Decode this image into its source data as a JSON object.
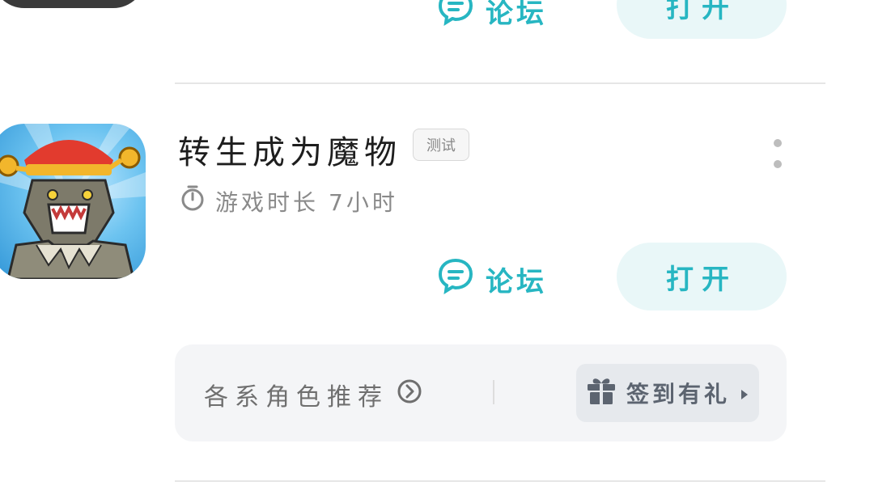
{
  "previous_item": {
    "forum_label": "论坛",
    "open_label": "打开"
  },
  "game": {
    "title": "转生成为魔物",
    "badge": "测试",
    "playtime_label": "游戏时长",
    "playtime_value": "7小时",
    "forum_label": "论坛",
    "open_label": "打开",
    "icon": "game-app-icon"
  },
  "panel": {
    "recommend_label": "各系角色推荐",
    "checkin_label": "签到有礼",
    "icons": {
      "recommend": "circle-chevron-right-icon",
      "checkin": "gift-icon",
      "arrow": "triangle-right-icon",
      "timer": "stopwatch-icon",
      "forum": "chat-bubble-icon",
      "more": "more-vertical-icon"
    }
  },
  "colors": {
    "accent": "#27b6c2",
    "accent_bg": "#e9f7f8",
    "panel_bg": "#f4f5f7",
    "checkin_bg": "#e6e9ed"
  }
}
